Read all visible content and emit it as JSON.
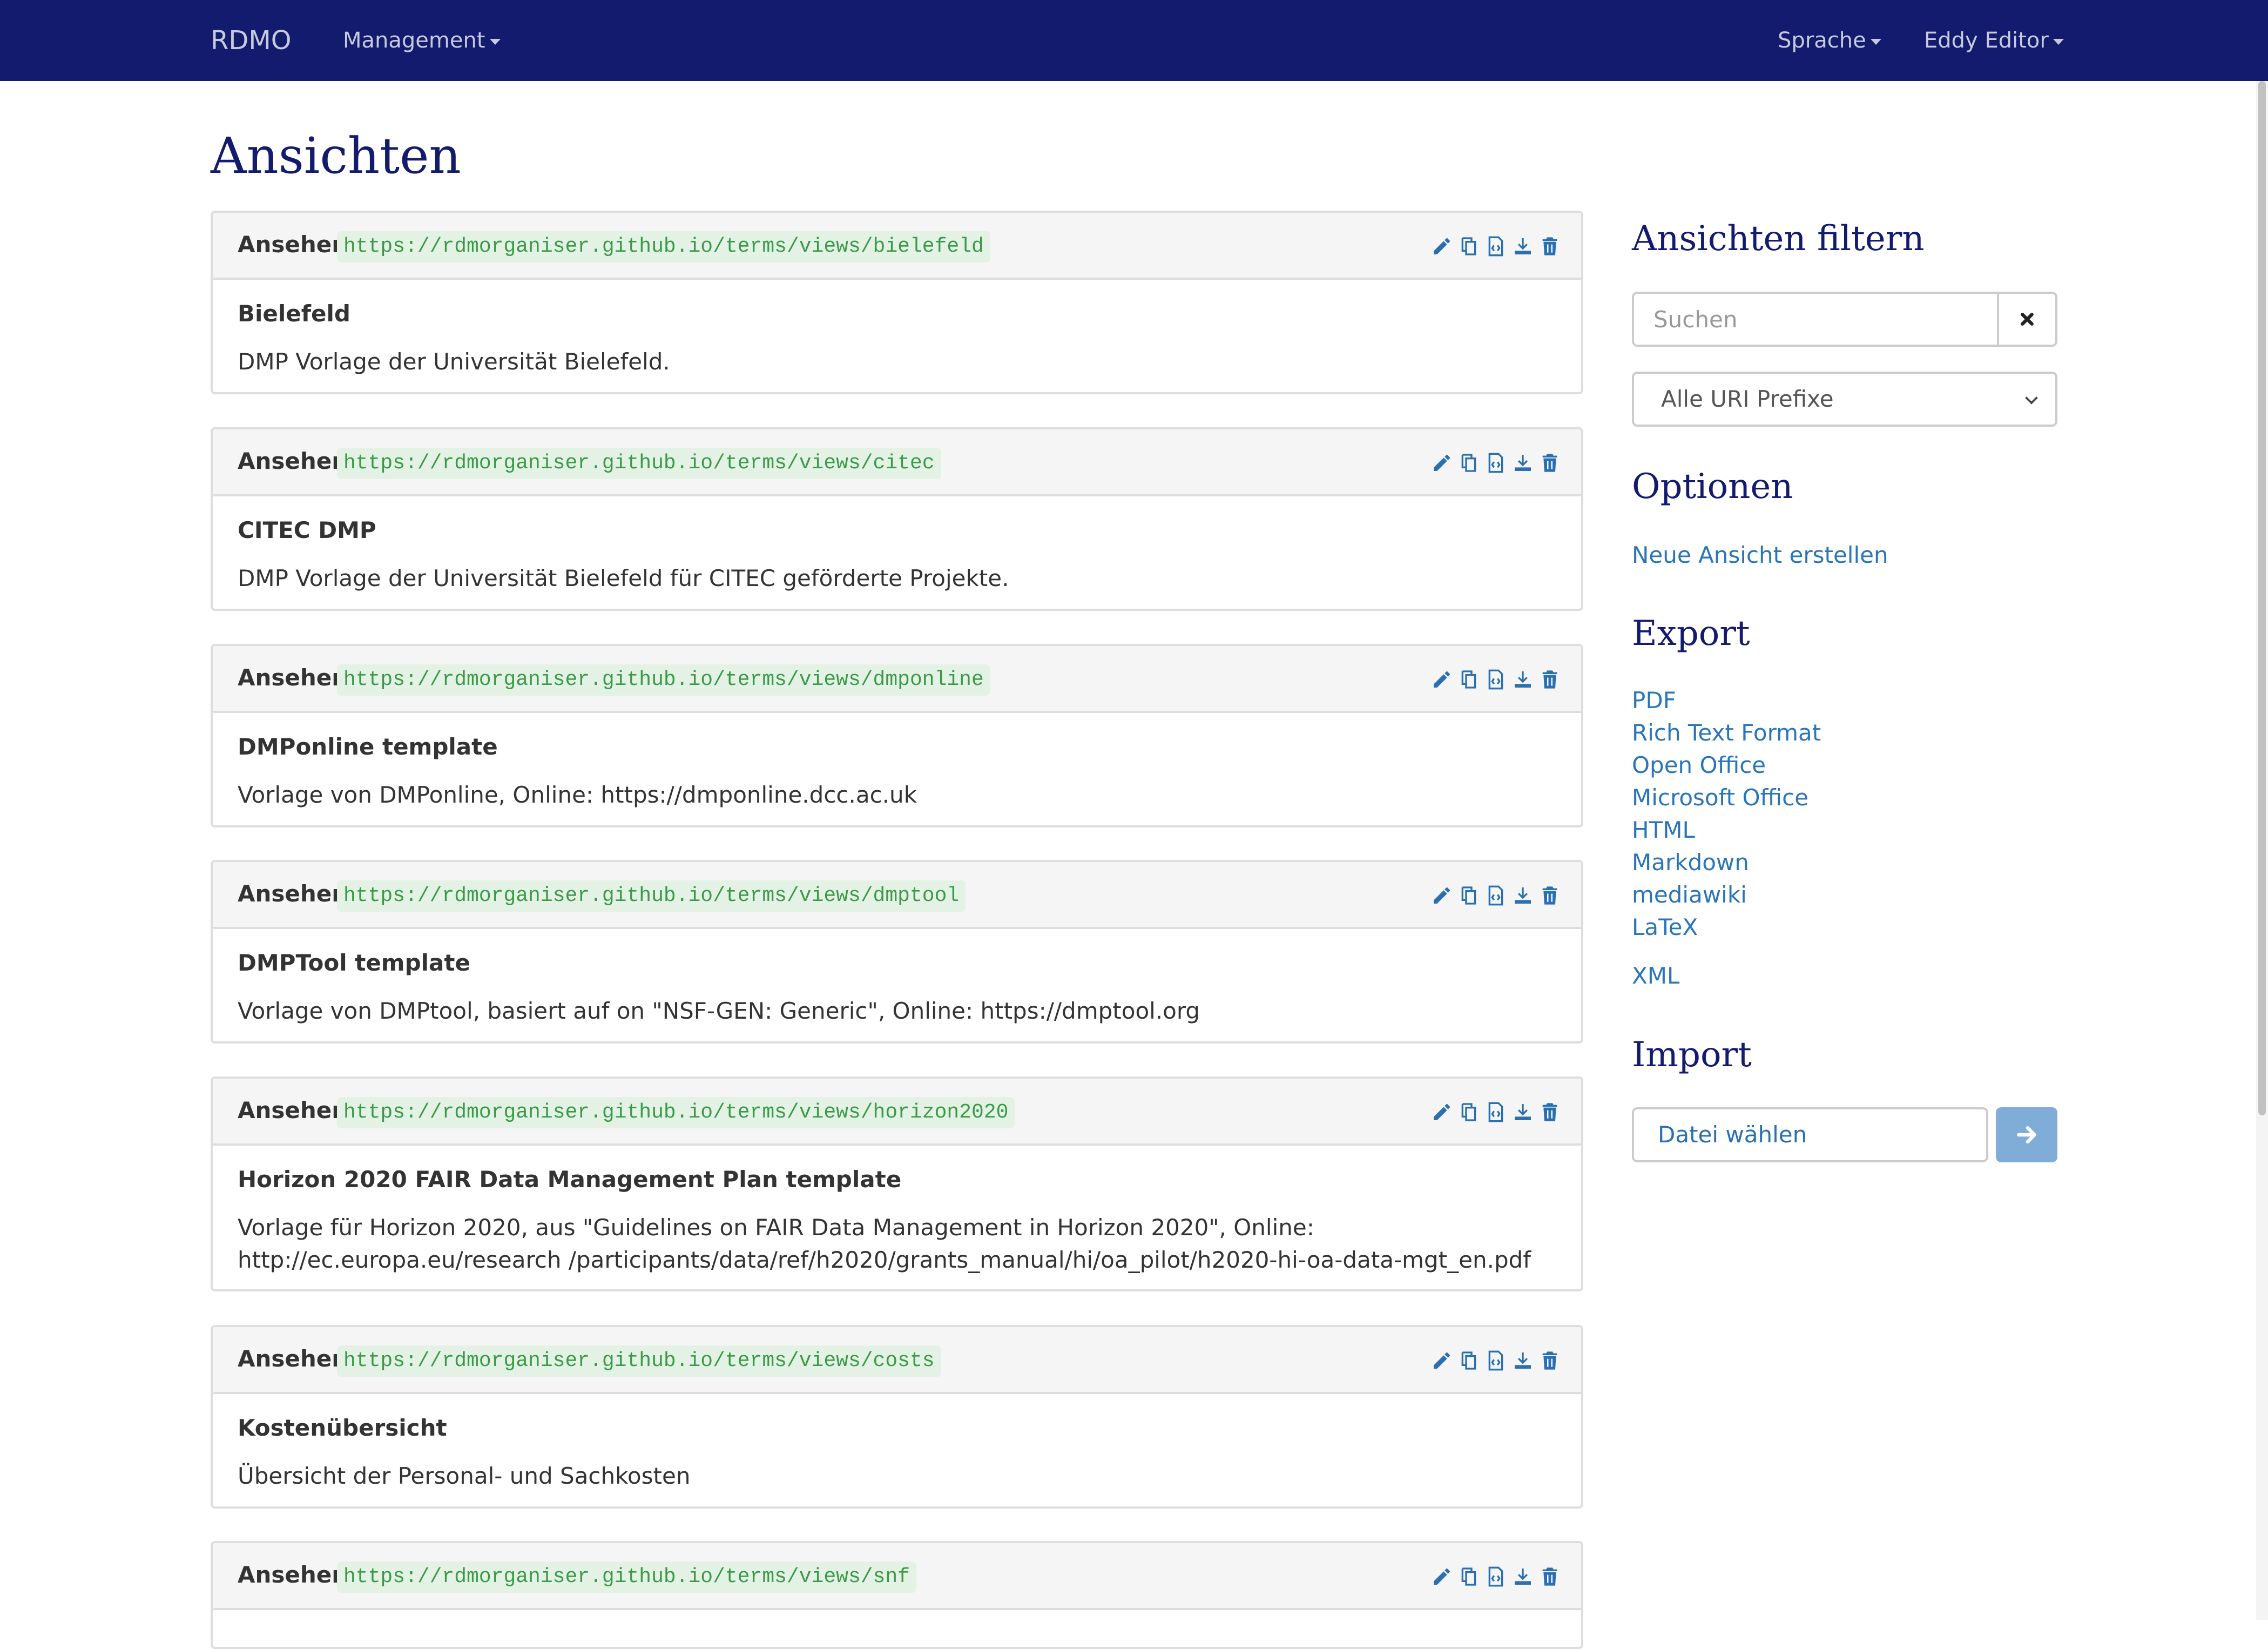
{
  "navbar": {
    "brand": "RDMO",
    "management": "Management",
    "language": "Sprache",
    "user": "Eddy Editor"
  },
  "page_title": "Ansichten",
  "panel_label": "Ansehen",
  "views": [
    {
      "uri": "https://rdmorganiser.github.io/terms/views/bielefeld",
      "title": "Bielefeld",
      "description": "DMP Vorlage der Universität Bielefeld."
    },
    {
      "uri": "https://rdmorganiser.github.io/terms/views/citec",
      "title": "CITEC DMP",
      "description": "DMP Vorlage der Universität Bielefeld für CITEC geförderte Projekte."
    },
    {
      "uri": "https://rdmorganiser.github.io/terms/views/dmponline",
      "title": "DMPonline template",
      "description": "Vorlage von DMPonline, Online: https://dmponline.dcc.ac.uk"
    },
    {
      "uri": "https://rdmorganiser.github.io/terms/views/dmptool",
      "title": "DMPTool template",
      "description": "Vorlage von DMPtool, basiert auf on \"NSF-GEN: Generic\", Online: https://dmptool.org"
    },
    {
      "uri": "https://rdmorganiser.github.io/terms/views/horizon2020",
      "title": "Horizon 2020 FAIR Data Management Plan template",
      "description": "Vorlage für Horizon 2020, aus \"Guidelines on FAIR Data Management in Horizon 2020\", Online: http://ec.europa.eu/research /participants/data/ref/h2020/grants_manual/hi/oa_pilot/h2020-hi-oa-data-mgt_en.pdf"
    },
    {
      "uri": "https://rdmorganiser.github.io/terms/views/costs",
      "title": "Kostenübersicht",
      "description": "Übersicht der Personal- und Sachkosten"
    },
    {
      "uri": "https://rdmorganiser.github.io/terms/views/snf",
      "title": "",
      "description": ""
    }
  ],
  "sidebar": {
    "filter_heading": "Ansichten filtern",
    "search_placeholder": "Suchen",
    "uri_prefix_selected": "Alle URI Prefixe",
    "options_heading": "Optionen",
    "new_view": "Neue Ansicht erstellen",
    "export_heading": "Export",
    "export_formats": [
      "PDF",
      "Rich Text Format",
      "Open Office",
      "Microsoft Office",
      "HTML",
      "Markdown",
      "mediawiki",
      "LaTeX"
    ],
    "xml": "XML",
    "import_heading": "Import",
    "file_label": "Datei wählen"
  },
  "colors": {
    "navbar": "#131b6f",
    "link": "#2a75b8",
    "uri_bg": "#e4f2e5",
    "uri_text": "#3a9a47",
    "import_button": "#80acd8"
  },
  "icons": [
    "pencil-icon",
    "copy-icon",
    "code-file-icon",
    "download-icon",
    "trash-icon",
    "close-icon",
    "chevron-down-icon",
    "arrow-right-icon",
    "caret-down-icon"
  ]
}
